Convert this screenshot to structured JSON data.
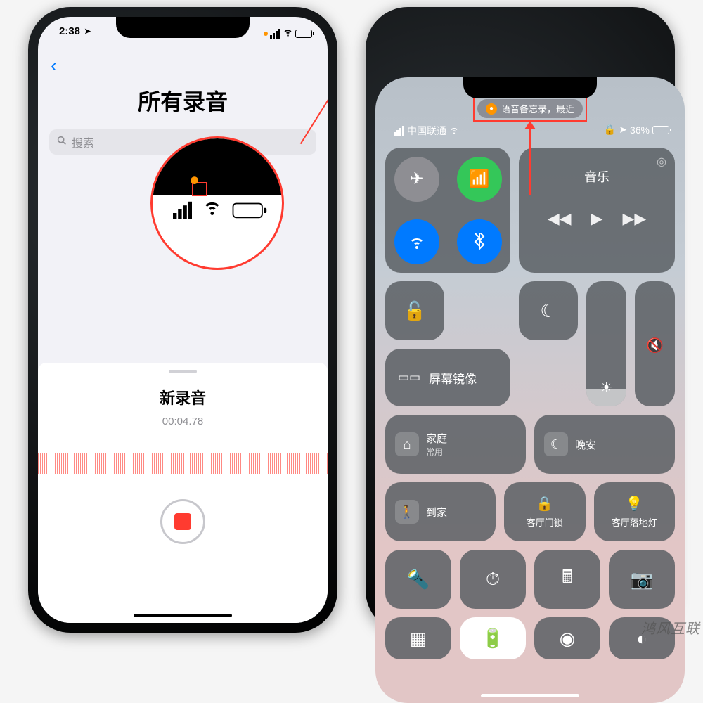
{
  "left": {
    "time": "2:38",
    "location_glyph": "➤",
    "back_glyph": "‹",
    "title": "所有录音",
    "search_placeholder": "搜索",
    "recording_title": "新录音",
    "recording_time": "00:04.78",
    "battery_pct_width": "40%"
  },
  "right": {
    "pill_text": "语音备忘录，最近",
    "carrier": "中国联通",
    "battery_text": "36%",
    "music_label": "音乐",
    "mirror_label": "屏幕镜像",
    "home_label": "家庭",
    "home_sub": "常用",
    "goodnight_label": "晚安",
    "arrive_label": "到家",
    "lock_label": "客厅门锁",
    "lamp_label": "客厅落地灯"
  },
  "watermark": "鸿风互联"
}
